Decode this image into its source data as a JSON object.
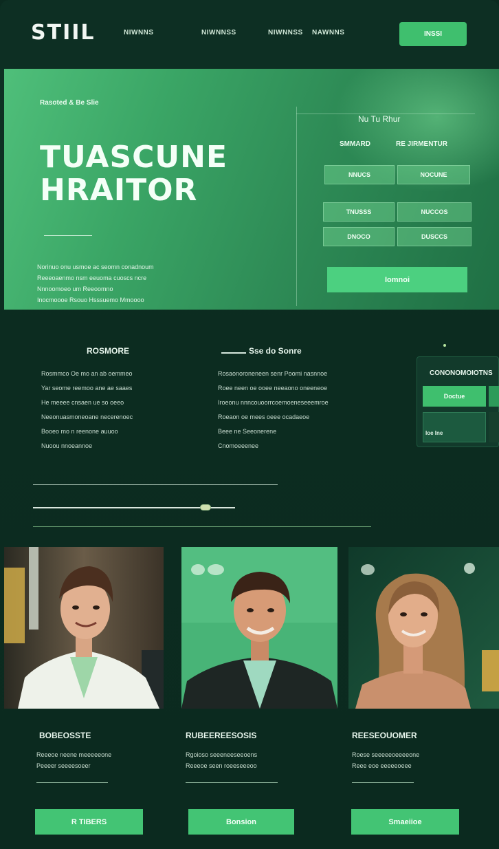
{
  "nav": {
    "logo": "STIIL",
    "links": [
      "NIWNNS",
      "NIWNNSS",
      "NIWNNSS",
      "NAWNNS"
    ],
    "cta": "INSSI"
  },
  "hero": {
    "eyebrow": "Rasoted & Be Slie",
    "title_line1": "TUASCUNE",
    "title_line2": "HRAITOR",
    "body_lines": [
      "Norinuo onu usmoe ac seomn conadnoum",
      "Reeeoaenmo nsm eeuoma cuoscs ncre",
      "Nnnoomoeo um Reeoomno",
      "Inocmoooe Rsouo Hsssuemo Mmoooo"
    ],
    "panel_title": "Nu Tu Rhur",
    "grid_heads": [
      "SMMARD",
      "RE JIRMENTUR"
    ],
    "cells": [
      "NNUCS",
      "NOCUNE",
      "TNUSSS",
      "NUCCOS",
      "DNOCO",
      "DUSCCS"
    ],
    "cta": "Iomnoi"
  },
  "features": {
    "col1_title": "ROSMORE",
    "col1_lines": [
      "Rosmmco Oe mo an ab oemmeo",
      "Yar seome reemoo ane ae saaes",
      "He meeee cnsaen ue so oeeo",
      "Neeonuasmoneoane necerenoec",
      "Booeo mo n reenone auuoo",
      "Nuoou nnoeannoe"
    ],
    "col2_title": "Sse do Sonre",
    "col2_lines": [
      "Rosaonoroneneen senr Poomi nasnnoe",
      "Roee neen oe ooee neeaono oneeneoe",
      "Iroeonu nnncouoorrcoemoeneseeemroe",
      "Roeaon oe mees oeee ocadaeoe",
      "Beee ne Seeonerene",
      "Cnomoeeenee"
    ],
    "side_title": "CONONOMOIOTNS",
    "side_button": "Doctue",
    "side_chip": "Ioe Ine"
  },
  "profiles": [
    {
      "name": "BOBEOSSTE",
      "meta1": "Reeeoe neene meeeeeone",
      "meta2": "Peeeer seeeesoeer",
      "button": "R TIBERS"
    },
    {
      "name": "RUBEEREESOSIS",
      "meta1": "Rgoioso seeeneeseeoens",
      "meta2": "Reeeoe seen roeeseeeoo",
      "button": "Bonsion"
    },
    {
      "name": "REESEOUOMER",
      "meta1": "Roese seeeeeoeeeeone",
      "meta2": "Reee eoe eeeeeoeee",
      "button": "Smaeiioe"
    }
  ],
  "colors": {
    "background": "#0b2a1f",
    "accent": "#43c474",
    "hero": "#3aa565"
  }
}
